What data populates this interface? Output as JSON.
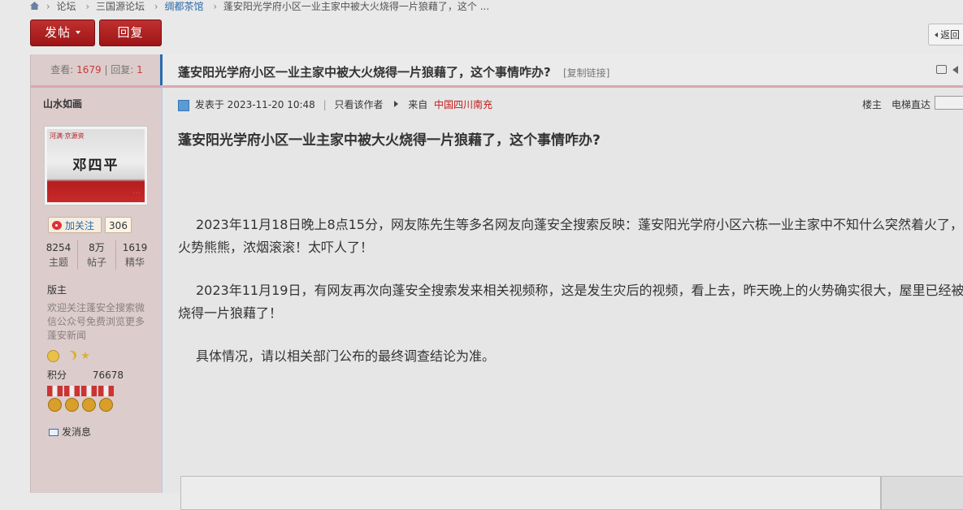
{
  "breadcrumb": {
    "items": [
      "论坛",
      "三国源论坛",
      "绸都茶馆",
      "蓬安阳光学府小区一业主家中被大火烧得一片狼藉了，这个 ..."
    ]
  },
  "toolbar": {
    "post_label": "发帖",
    "reply_label": "回复",
    "back_label": "返回"
  },
  "thread": {
    "views_label": "查看:",
    "views": "1679",
    "replies_label": "回复:",
    "replies": "1",
    "title": "蓬安阳光学府小区一业主家中被大火烧得一片狼藉了，这个事情咋办?",
    "copy_link": "[复制链接]"
  },
  "author": {
    "name": "山水如画",
    "avatar_brand": "河满·京源资",
    "avatar_text": "邓四平",
    "follow_label": "加关注",
    "followers": "306",
    "stats": [
      {
        "value": "8254",
        "label": "主题"
      },
      {
        "value": "8万",
        "label": "帖子"
      },
      {
        "value": "1619",
        "label": "精华"
      }
    ],
    "role": "版主",
    "bio": "欢迎关注蓬安全搜索微信公众号免费浏览更多蓬安新闻",
    "points_label": "积分",
    "points": "76678",
    "message_label": "发消息"
  },
  "post": {
    "posted_prefix": "发表于",
    "posted_time": "2023-11-20 10:48",
    "only_author": "只看该作者",
    "from_prefix": "来自",
    "location": "中国四川南充",
    "floor_label": "楼主",
    "elevator_label": "电梯直达",
    "content_title": "蓬安阳光学府小区一业主家中被大火烧得一片狼藉了，这个事情咋办?",
    "paragraphs": [
      "2023年11月18日晚上8点15分，网友陈先生等多名网友向蓬安全搜索反映：蓬安阳光学府小区六栋一业主家中不知什么突然着火了，火势熊熊，浓烟滚滚！太吓人了！",
      "2023年11月19日，有网友再次向蓬安全搜索发来相关视频称，这是发生灾后的视频，看上去，昨天晚上的火势确实很大，屋里已经被烧得一片狼藉了！",
      "具体情况，请以相关部门公布的最终调查结论为准。"
    ]
  },
  "icons": {
    "home": "home-icon",
    "print": "print-icon",
    "prev": "prev-thread-icon",
    "weibo": "weibo-icon",
    "mail": "mail-icon",
    "user": "user-icon"
  }
}
